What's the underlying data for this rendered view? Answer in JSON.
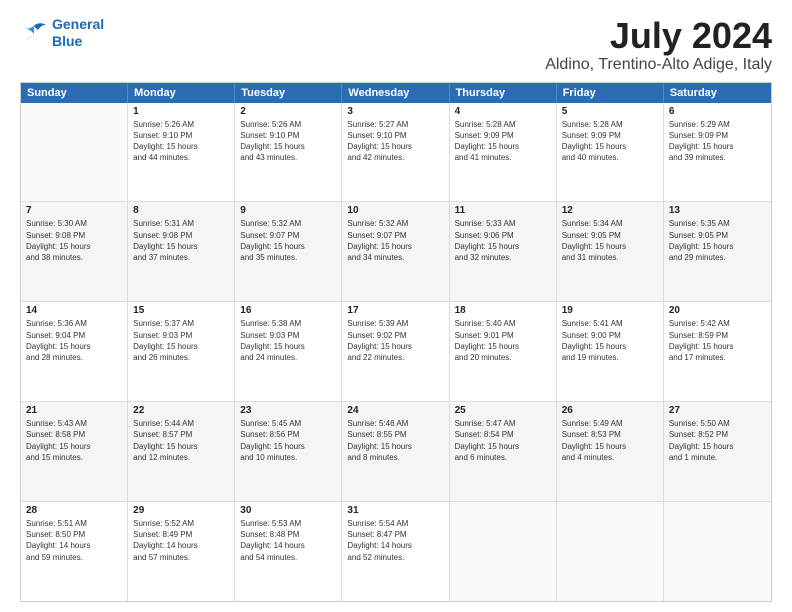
{
  "logo": {
    "line1": "General",
    "line2": "Blue"
  },
  "title": "July 2024",
  "subtitle": "Aldino, Trentino-Alto Adige, Italy",
  "header_days": [
    "Sunday",
    "Monday",
    "Tuesday",
    "Wednesday",
    "Thursday",
    "Friday",
    "Saturday"
  ],
  "rows": [
    [
      {
        "day": "",
        "text": "",
        "empty": true
      },
      {
        "day": "1",
        "text": "Sunrise: 5:26 AM\nSunset: 9:10 PM\nDaylight: 15 hours\nand 44 minutes.",
        "shaded": false
      },
      {
        "day": "2",
        "text": "Sunrise: 5:26 AM\nSunset: 9:10 PM\nDaylight: 15 hours\nand 43 minutes.",
        "shaded": false
      },
      {
        "day": "3",
        "text": "Sunrise: 5:27 AM\nSunset: 9:10 PM\nDaylight: 15 hours\nand 42 minutes.",
        "shaded": false
      },
      {
        "day": "4",
        "text": "Sunrise: 5:28 AM\nSunset: 9:09 PM\nDaylight: 15 hours\nand 41 minutes.",
        "shaded": false
      },
      {
        "day": "5",
        "text": "Sunrise: 5:28 AM\nSunset: 9:09 PM\nDaylight: 15 hours\nand 40 minutes.",
        "shaded": false
      },
      {
        "day": "6",
        "text": "Sunrise: 5:29 AM\nSunset: 9:09 PM\nDaylight: 15 hours\nand 39 minutes.",
        "shaded": false
      }
    ],
    [
      {
        "day": "7",
        "text": "Sunrise: 5:30 AM\nSunset: 9:08 PM\nDaylight: 15 hours\nand 38 minutes.",
        "shaded": true
      },
      {
        "day": "8",
        "text": "Sunrise: 5:31 AM\nSunset: 9:08 PM\nDaylight: 15 hours\nand 37 minutes.",
        "shaded": true
      },
      {
        "day": "9",
        "text": "Sunrise: 5:32 AM\nSunset: 9:07 PM\nDaylight: 15 hours\nand 35 minutes.",
        "shaded": true
      },
      {
        "day": "10",
        "text": "Sunrise: 5:32 AM\nSunset: 9:07 PM\nDaylight: 15 hours\nand 34 minutes.",
        "shaded": true
      },
      {
        "day": "11",
        "text": "Sunrise: 5:33 AM\nSunset: 9:06 PM\nDaylight: 15 hours\nand 32 minutes.",
        "shaded": true
      },
      {
        "day": "12",
        "text": "Sunrise: 5:34 AM\nSunset: 9:05 PM\nDaylight: 15 hours\nand 31 minutes.",
        "shaded": true
      },
      {
        "day": "13",
        "text": "Sunrise: 5:35 AM\nSunset: 9:05 PM\nDaylight: 15 hours\nand 29 minutes.",
        "shaded": true
      }
    ],
    [
      {
        "day": "14",
        "text": "Sunrise: 5:36 AM\nSunset: 9:04 PM\nDaylight: 15 hours\nand 28 minutes.",
        "shaded": false
      },
      {
        "day": "15",
        "text": "Sunrise: 5:37 AM\nSunset: 9:03 PM\nDaylight: 15 hours\nand 26 minutes.",
        "shaded": false
      },
      {
        "day": "16",
        "text": "Sunrise: 5:38 AM\nSunset: 9:03 PM\nDaylight: 15 hours\nand 24 minutes.",
        "shaded": false
      },
      {
        "day": "17",
        "text": "Sunrise: 5:39 AM\nSunset: 9:02 PM\nDaylight: 15 hours\nand 22 minutes.",
        "shaded": false
      },
      {
        "day": "18",
        "text": "Sunrise: 5:40 AM\nSunset: 9:01 PM\nDaylight: 15 hours\nand 20 minutes.",
        "shaded": false
      },
      {
        "day": "19",
        "text": "Sunrise: 5:41 AM\nSunset: 9:00 PM\nDaylight: 15 hours\nand 19 minutes.",
        "shaded": false
      },
      {
        "day": "20",
        "text": "Sunrise: 5:42 AM\nSunset: 8:59 PM\nDaylight: 15 hours\nand 17 minutes.",
        "shaded": false
      }
    ],
    [
      {
        "day": "21",
        "text": "Sunrise: 5:43 AM\nSunset: 8:58 PM\nDaylight: 15 hours\nand 15 minutes.",
        "shaded": true
      },
      {
        "day": "22",
        "text": "Sunrise: 5:44 AM\nSunset: 8:57 PM\nDaylight: 15 hours\nand 12 minutes.",
        "shaded": true
      },
      {
        "day": "23",
        "text": "Sunrise: 5:45 AM\nSunset: 8:56 PM\nDaylight: 15 hours\nand 10 minutes.",
        "shaded": true
      },
      {
        "day": "24",
        "text": "Sunrise: 5:46 AM\nSunset: 8:55 PM\nDaylight: 15 hours\nand 8 minutes.",
        "shaded": true
      },
      {
        "day": "25",
        "text": "Sunrise: 5:47 AM\nSunset: 8:54 PM\nDaylight: 15 hours\nand 6 minutes.",
        "shaded": true
      },
      {
        "day": "26",
        "text": "Sunrise: 5:49 AM\nSunset: 8:53 PM\nDaylight: 15 hours\nand 4 minutes.",
        "shaded": true
      },
      {
        "day": "27",
        "text": "Sunrise: 5:50 AM\nSunset: 8:52 PM\nDaylight: 15 hours\nand 1 minute.",
        "shaded": true
      }
    ],
    [
      {
        "day": "28",
        "text": "Sunrise: 5:51 AM\nSunset: 8:50 PM\nDaylight: 14 hours\nand 59 minutes.",
        "shaded": false
      },
      {
        "day": "29",
        "text": "Sunrise: 5:52 AM\nSunset: 8:49 PM\nDaylight: 14 hours\nand 57 minutes.",
        "shaded": false
      },
      {
        "day": "30",
        "text": "Sunrise: 5:53 AM\nSunset: 8:48 PM\nDaylight: 14 hours\nand 54 minutes.",
        "shaded": false
      },
      {
        "day": "31",
        "text": "Sunrise: 5:54 AM\nSunset: 8:47 PM\nDaylight: 14 hours\nand 52 minutes.",
        "shaded": false
      },
      {
        "day": "",
        "text": "",
        "empty": true
      },
      {
        "day": "",
        "text": "",
        "empty": true
      },
      {
        "day": "",
        "text": "",
        "empty": true
      }
    ]
  ]
}
